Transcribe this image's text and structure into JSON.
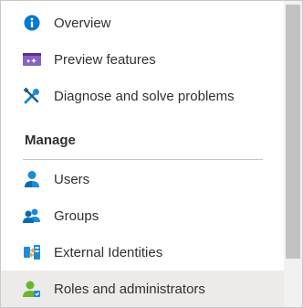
{
  "menu": {
    "items": [
      {
        "label": "Overview",
        "icon": "info-icon"
      },
      {
        "label": "Preview features",
        "icon": "preview-features-icon"
      },
      {
        "label": "Diagnose and solve problems",
        "icon": "wrench-screwdriver-icon"
      }
    ],
    "manage_header": "Manage",
    "manage_items": [
      {
        "label": "Users",
        "icon": "user-icon"
      },
      {
        "label": "Groups",
        "icon": "groups-icon"
      },
      {
        "label": "External Identities",
        "icon": "external-identities-icon"
      },
      {
        "label": "Roles and administrators",
        "icon": "roles-admin-icon",
        "selected": true
      }
    ]
  },
  "colors": {
    "accent": "#0078d4",
    "selected_bg": "#edebe9",
    "text": "#323130",
    "preview_purple": "#8661c5",
    "tools_blue": "#1f8ad6",
    "green": "#6bb52d"
  }
}
